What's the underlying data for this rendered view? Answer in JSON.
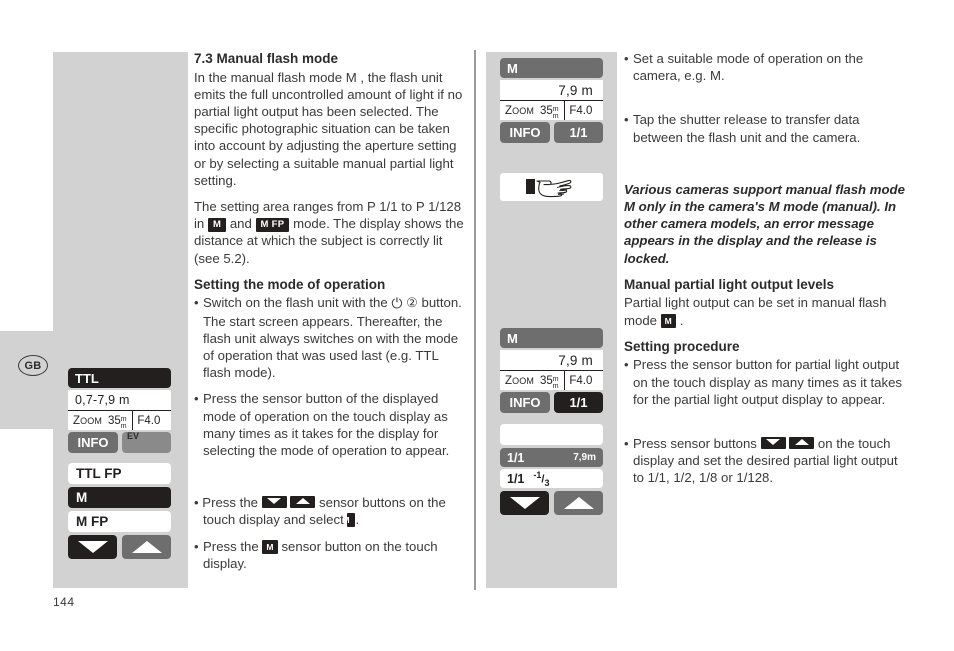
{
  "page": {
    "number": "144",
    "language_tab": "GB"
  },
  "left_panel": {
    "lcd": {
      "mode_bar": "TTL",
      "distance": "0,7-7,9 m",
      "zoom_label": "Zoom",
      "zoom_value": "35",
      "zoom_unit": "mm",
      "aperture": "F4.0",
      "info_button": "INFO",
      "ev_button": "EV",
      "mode_list": [
        "TTL FP",
        "M",
        "M FP"
      ],
      "arrow_down_icon": "triangle-down-icon",
      "arrow_up_icon": "triangle-up-icon"
    }
  },
  "body_column": {
    "heading": "7.3 Manual flash mode",
    "p1": "In the manual flash mode M , the flash unit emits the full uncontrolled amount of light if no partial light output has been selected. The specific photographic situation can be taken into account by adjusting the aperture setting or by selecting a suitable manual partial light setting.",
    "p2_a": "The setting area ranges from P 1/1 to P 1/128 in",
    "p2_tag1": "M",
    "p2_b": "and",
    "p2_tag2": "M FP",
    "p2_c": "mode. The display shows the distance at which the subject is correctly lit (see 5.2).",
    "subheading": "Setting the mode of operation",
    "bullet1_a": "Switch on the flash unit with the",
    "bullet1_power_icon": "power-icon",
    "bullet1_num": "②",
    "bullet1_b": "button. The start screen appears. Thereafter, the flash unit always switches on with the mode of operation that was used last (e.g. TTL flash mode).",
    "bullet2": "Press the sensor button of the displayed mode of operation on the touch display as many times as it takes for the display for selecting the mode of operation to appear.",
    "bullet3_a": "Press the",
    "bullet3_icon_down": "arrow-down-icon",
    "bullet3_icon_up": "arrow-up-icon",
    "bullet3_b": "sensor buttons on the touch display and select",
    "bullet3_tag": "M",
    "bullet3_c": ".",
    "bullet4_a": "Press the",
    "bullet4_tag": "M",
    "bullet4_b": "sensor button on the touch display."
  },
  "mid_panel": {
    "lcd_top": {
      "mode_bar": "M",
      "distance": "7,9 m",
      "zoom_label": "Zoom",
      "zoom_value": "35",
      "zoom_unit": "mm",
      "aperture": "F4.0",
      "info_button": "INFO",
      "ratio_button": "1/1"
    },
    "hand_icon": "pointing-hand-icon",
    "lcd_bottom": {
      "mode_bar": "M",
      "distance": "7,9 m",
      "zoom_label": "Zoom",
      "zoom_value": "35",
      "zoom_unit": "mm",
      "aperture": "F4.0",
      "info_button": "INFO",
      "ratio_button": "1/1",
      "blank_row": "",
      "level_row_left": "1/1",
      "level_row_right": "7,9m",
      "adjust_row_left": "1/1",
      "adjust_row_frac_sup": "-1",
      "adjust_row_frac_sub": "3",
      "arrow_down_icon": "triangle-down-icon",
      "arrow_up_icon": "triangle-up-icon"
    }
  },
  "right_column": {
    "bullet1": "Set a suitable mode of operation on the camera, e.g. M.",
    "bullet2": "Tap the shutter release to transfer data between the flash unit and the camera.",
    "note": "Various cameras support manual flash mode M only in the camera's M mode (manual). In other camera models, an error message appears in the display and the release is locked.",
    "subheading1": "Manual partial light output levels",
    "p1_a": "Partial light output can be set in manual flash mode",
    "p1_tag": "M",
    "p1_b": ".",
    "subheading2": "Setting procedure",
    "bullet3": "Press the sensor button for partial light output on the touch display as many times as it takes for the partial light output display to appear.",
    "bullet4_a": "Press sensor buttons",
    "bullet4_icon_down": "arrow-down-icon",
    "bullet4_icon_up": "arrow-up-icon",
    "bullet4_b": "on the touch display and set the desired partial light output to 1/1, 1/2, 1/8 or 1/128."
  },
  "colors": {
    "panel_gray": "#d2d2d2",
    "lcd_dark": "#231f1f",
    "lcd_gray": "#6e6e6e",
    "text": "#3a3a3a"
  }
}
